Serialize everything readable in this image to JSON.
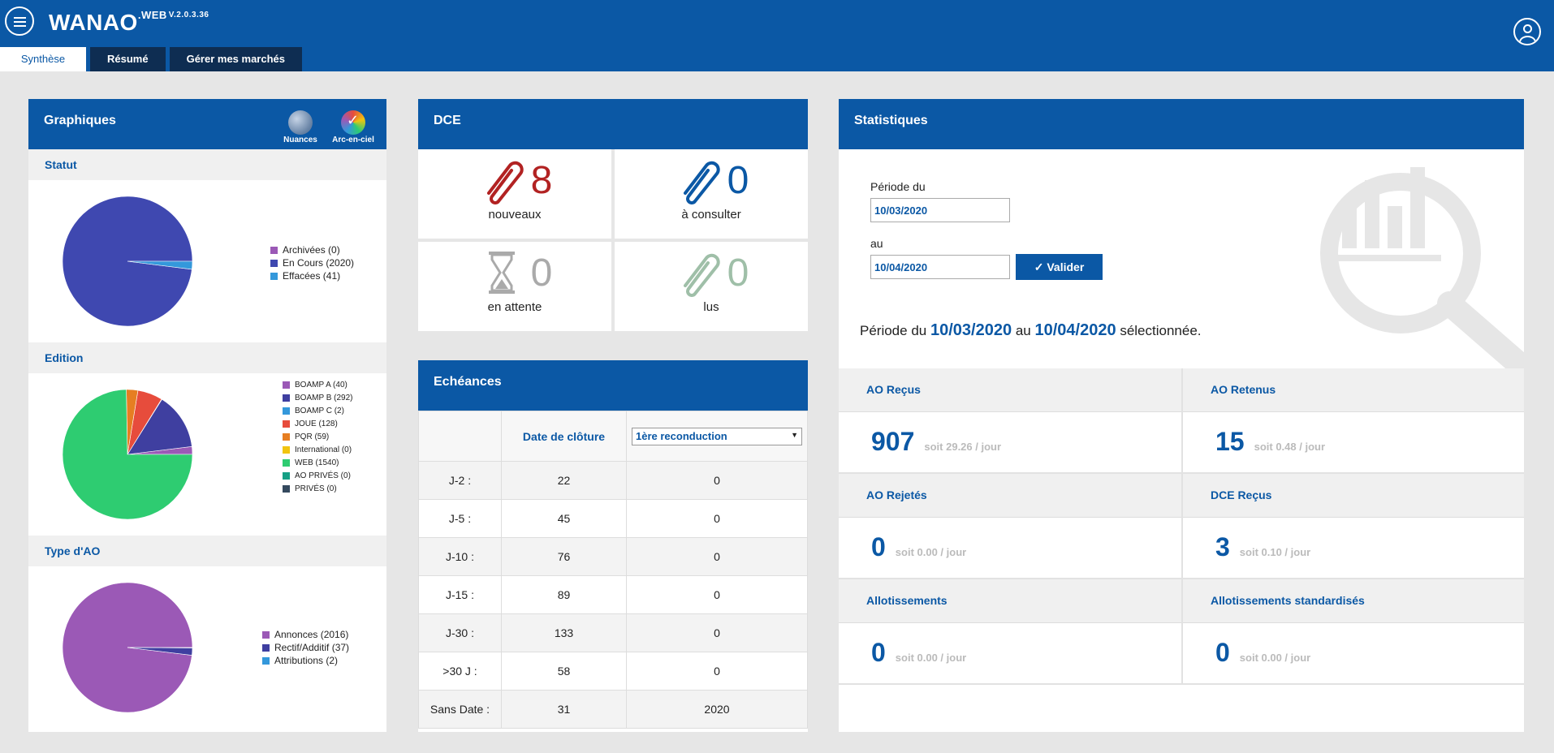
{
  "app": {
    "name": "WANAO",
    "sup": ".WEB",
    "version": "V.2.0.3.36"
  },
  "tabs": [
    {
      "label": "Synthèse"
    },
    {
      "label": "Résumé"
    },
    {
      "label": "Gérer mes marchés"
    }
  ],
  "graphiques": {
    "title": "Graphiques",
    "palettes": [
      {
        "label": "Nuances",
        "icon": "nuances-palette-icon"
      },
      {
        "label": "Arc-en-ciel",
        "icon": "rainbow-palette-icon"
      }
    ],
    "sections": [
      {
        "title": "Statut"
      },
      {
        "title": "Edition"
      },
      {
        "title": "Type d'AO"
      }
    ]
  },
  "chart_data": [
    {
      "type": "pie",
      "title": "Statut",
      "categories": [
        "Archivées (0)",
        "En Cours (2020)",
        "Effacées (41)"
      ],
      "values": [
        0,
        2020,
        41
      ],
      "colors": [
        "#9b59b6",
        "#3f48b0",
        "#3498db"
      ],
      "legend": "right"
    },
    {
      "type": "pie",
      "title": "Edition",
      "categories": [
        "BOAMP A (40)",
        "BOAMP B (292)",
        "BOAMP C (2)",
        "JOUE (128)",
        "PQR (59)",
        "International (0)",
        "WEB (1540)",
        "AO PRIVÉS (0)",
        "PRIVÉS (0)"
      ],
      "values": [
        40,
        292,
        2,
        128,
        59,
        0,
        1540,
        0,
        0
      ],
      "colors": [
        "#9b59b6",
        "#3f3fa0",
        "#3498db",
        "#e74c3c",
        "#e67e22",
        "#f1c40f",
        "#2ecc71",
        "#16a085",
        "#34495e"
      ],
      "legend": "right"
    },
    {
      "type": "pie",
      "title": "Type d'AO",
      "categories": [
        "Annonces (2016)",
        "Rectif/Additif (37)",
        "Attributions (2)"
      ],
      "values": [
        2016,
        37,
        2
      ],
      "colors": [
        "#9b59b6",
        "#3f3fa0",
        "#3498db"
      ],
      "legend": "right"
    }
  ],
  "dce": {
    "title": "DCE",
    "cells": [
      {
        "value": "8",
        "label": "nouveaux",
        "color": "#b22222",
        "icon": "paperclip-icon"
      },
      {
        "value": "0",
        "label": "à consulter",
        "color": "#0b58a5",
        "icon": "paperclip-icon"
      },
      {
        "value": "0",
        "label": "en attente",
        "color": "#aaaaaa",
        "icon": "hourglass-icon"
      },
      {
        "value": "0",
        "label": "lus",
        "color": "#9fbfa8",
        "icon": "paperclip-icon"
      }
    ]
  },
  "echeances": {
    "title": "Echéances",
    "col_date": "Date de clôture",
    "select_value": "1ère reconduction",
    "rows": [
      {
        "label": "J-2 :",
        "date": "22",
        "recond": "0"
      },
      {
        "label": "J-5 :",
        "date": "45",
        "recond": "0"
      },
      {
        "label": "J-10 :",
        "date": "76",
        "recond": "0"
      },
      {
        "label": "J-15 :",
        "date": "89",
        "recond": "0"
      },
      {
        "label": "J-30 :",
        "date": "133",
        "recond": "0"
      },
      {
        "label": ">30 J :",
        "date": "58",
        "recond": "0"
      },
      {
        "label": "Sans Date :",
        "date": "31",
        "recond": "2020"
      }
    ]
  },
  "stats": {
    "title": "Statistiques",
    "periode_du_label": "Période du",
    "au_label": "au",
    "date_from": "10/03/2020",
    "date_to": "10/04/2020",
    "valider_label": "Valider",
    "sel_prefix": "Période du",
    "sel_mid": "au",
    "sel_suffix": "sélectionnée.",
    "kpis": [
      {
        "title": "AO Reçus",
        "value": "907",
        "sub": "soit 29.26 / jour"
      },
      {
        "title": "AO Retenus",
        "value": "15",
        "sub": "soit 0.48 / jour"
      },
      {
        "title": "AO Rejetés",
        "value": "0",
        "sub": "soit 0.00 / jour"
      },
      {
        "title": "DCE Reçus",
        "value": "3",
        "sub": "soit 0.10 / jour"
      },
      {
        "title": "Allotissements",
        "value": "0",
        "sub": "soit 0.00 / jour"
      },
      {
        "title": "Allotissements standardisés",
        "value": "0",
        "sub": "soit 0.00 / jour"
      }
    ]
  }
}
